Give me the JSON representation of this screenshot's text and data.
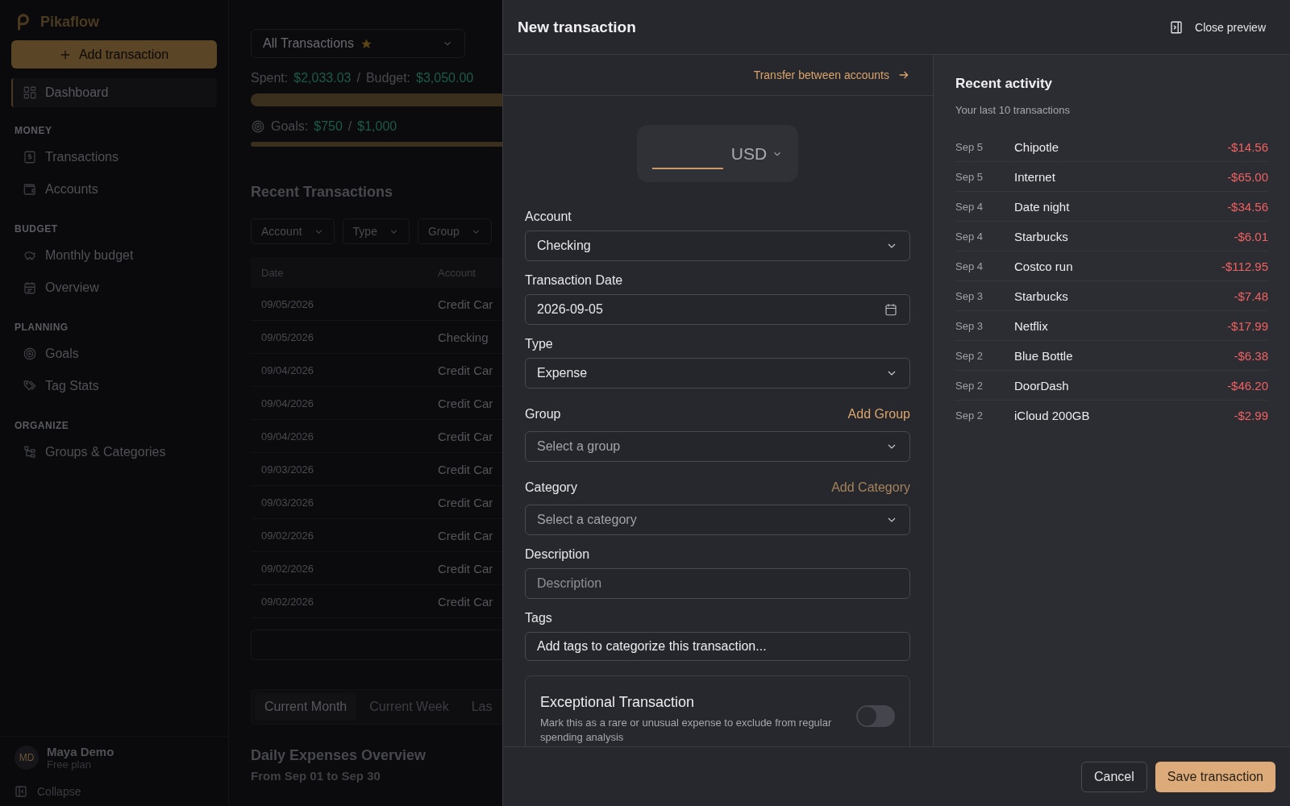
{
  "sidebar": {
    "brand": "Pikaflow",
    "primary_button": "Add transaction",
    "sections": [
      {
        "items": [
          {
            "label": "Dashboard",
            "selected": true
          }
        ]
      },
      {
        "heading": "MONEY",
        "items": [
          {
            "label": "Transactions",
            "selected": false
          },
          {
            "label": "Accounts",
            "selected": false
          }
        ]
      },
      {
        "heading": "BUDGET",
        "items": [
          {
            "label": "Monthly budget",
            "selected": false
          },
          {
            "label": "Overview",
            "selected": false
          }
        ]
      },
      {
        "heading": "PLANNING",
        "items": [
          {
            "label": "Goals",
            "selected": false
          },
          {
            "label": "Tag Stats",
            "selected": false
          }
        ]
      },
      {
        "heading": "ORGANIZE",
        "items": [
          {
            "label": "Groups & Categories",
            "selected": false
          }
        ]
      }
    ],
    "user": {
      "initials": "MD",
      "name": "Maya Demo",
      "plan": "Free plan"
    },
    "collapse": "Collapse"
  },
  "main": {
    "view_select": {
      "value": "All Transactions",
      "starred": true
    },
    "budget_bar": {
      "level": 1
    },
    "goals_bar": {
      "level": 1
    },
    "spent_label": "Spent:",
    "spent": "$2,033.03",
    "separator": "/",
    "budget_label": "Budget:",
    "budget": "$3,050.00",
    "goals_label": "Goals:",
    "goals": "$750",
    "goals_separator": "/",
    "goals_target": "$1,000",
    "section_title": "Recent Transactions",
    "filters": [
      "Account",
      "Type",
      "Group"
    ],
    "table": {
      "columns": [
        "Date",
        "Account"
      ],
      "rows": [
        [
          "09/05/2026",
          "Credit Car"
        ],
        [
          "09/05/2026",
          "Checking"
        ],
        [
          "09/04/2026",
          "Credit Car"
        ],
        [
          "09/04/2026",
          "Credit Car"
        ],
        [
          "09/04/2026",
          "Credit Car"
        ],
        [
          "09/03/2026",
          "Credit Car"
        ],
        [
          "09/03/2026",
          "Credit Car"
        ],
        [
          "09/02/2026",
          "Credit Car"
        ],
        [
          "09/02/2026",
          "Credit Car"
        ],
        [
          "09/02/2026",
          "Credit Car"
        ]
      ]
    },
    "period_tabs": [
      {
        "label": "Current Month",
        "selected": true
      },
      {
        "label": "Current Week",
        "selected": false
      },
      {
        "label": "Las",
        "selected": false
      }
    ],
    "chart_title": "Daily Expenses Overview",
    "chart_subtitle": "From Sep 01 to Sep 30"
  },
  "drawer": {
    "title": "New transaction",
    "close_label": "Close preview",
    "transfer_link": "Transfer between accounts",
    "amount": {
      "currency": "USD"
    },
    "fields": [
      {
        "kind": "select",
        "label": "Account",
        "value": "Checking"
      },
      {
        "kind": "date",
        "label": "Transaction Date",
        "value": "2026-09-05"
      },
      {
        "kind": "select",
        "label": "Type",
        "value": "Expense"
      },
      {
        "kind": "select",
        "label": "Group",
        "placeholder": "Select a group",
        "action": "Add Group",
        "action_disabled": false
      },
      {
        "kind": "select",
        "label": "Category",
        "placeholder": "Select a category",
        "action": "Add Category",
        "action_disabled": true
      },
      {
        "kind": "text",
        "label": "Description",
        "placeholder": "Description"
      },
      {
        "kind": "tags",
        "label": "Tags",
        "placeholder": "Add tags to categorize this transaction..."
      }
    ],
    "exceptional": {
      "title": "Exceptional Transaction",
      "description": "Mark this as a rare or unusual expense to exclude from regular spending analysis",
      "on": false
    },
    "recent": {
      "title": "Recent activity",
      "subtitle": "Your last 10 transactions",
      "rows": [
        {
          "date": "Sep 5",
          "name": "Chipotle",
          "amount": "-$14.56"
        },
        {
          "date": "Sep 5",
          "name": "Internet",
          "amount": "-$65.00"
        },
        {
          "date": "Sep 4",
          "name": "Date night",
          "amount": "-$34.56"
        },
        {
          "date": "Sep 4",
          "name": "Starbucks",
          "amount": "-$6.01"
        },
        {
          "date": "Sep 4",
          "name": "Costco run",
          "amount": "-$112.95"
        },
        {
          "date": "Sep 3",
          "name": "Starbucks",
          "amount": "-$7.48"
        },
        {
          "date": "Sep 3",
          "name": "Netflix",
          "amount": "-$17.99"
        },
        {
          "date": "Sep 2",
          "name": "Blue Bottle",
          "amount": "-$6.38"
        },
        {
          "date": "Sep 2",
          "name": "DoorDash",
          "amount": "-$46.20"
        },
        {
          "date": "Sep 2",
          "name": "iCloud 200GB",
          "amount": "-$2.99"
        }
      ]
    },
    "buttons": {
      "cancel": "Cancel",
      "save": "Save transaction"
    }
  }
}
